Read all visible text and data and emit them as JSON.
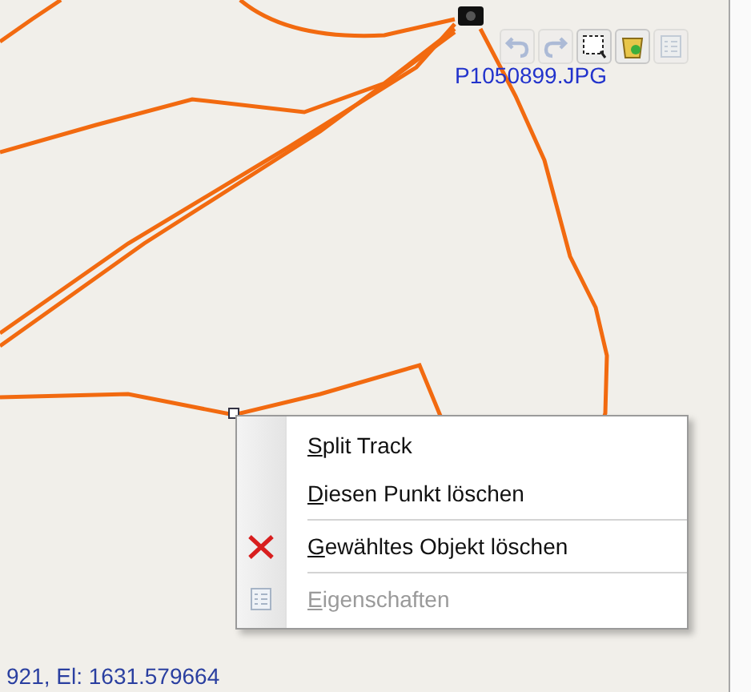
{
  "map": {
    "photo_label": "P1050899.JPG",
    "coordinates": "921, El: 1631.579664"
  },
  "toolbar": [
    {
      "kind": "undo",
      "disabled": true
    },
    {
      "kind": "redo",
      "disabled": true
    },
    {
      "kind": "select",
      "disabled": false
    },
    {
      "kind": "bin",
      "disabled": false
    },
    {
      "kind": "properties",
      "disabled": true
    }
  ],
  "context_menu": [
    {
      "kind": "item",
      "accel": "S",
      "rest": "plit Track",
      "disabled": false
    },
    {
      "kind": "item",
      "accel": "D",
      "rest": "iesen Punkt löschen",
      "disabled": false
    },
    {
      "kind": "separator"
    },
    {
      "kind": "delete",
      "accel": "G",
      "rest": "ewähltes Objekt löschen",
      "disabled": false
    },
    {
      "kind": "separator"
    },
    {
      "kind": "properties",
      "accel": "E",
      "rest": "igenschaften",
      "disabled": true
    }
  ]
}
